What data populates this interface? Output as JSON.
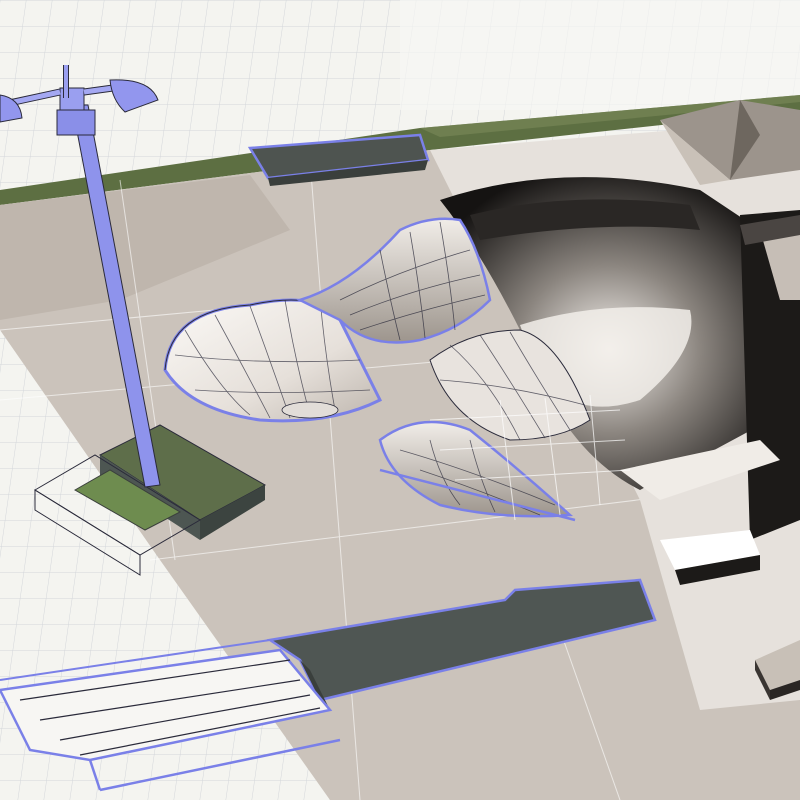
{
  "scene": {
    "subject": "skatepark-3d-model-viewport",
    "colors": {
      "background": "#f4f4f0",
      "grid_line": "#d8dadd",
      "grid_line_major": "#c4c7cc",
      "concrete": "#cbc3bb",
      "concrete_dark": "#a89f96",
      "deck_shadow": "#4e5450",
      "grass": "#5a7040",
      "wire_blue": "#7a80e8",
      "wire_edge": "#2a2a3a",
      "bowl_light": "#f3efeb",
      "bowl_dark": "#1e1c1a",
      "rendered_slab": "#e9e4df"
    },
    "objects": [
      "light-pole",
      "pole-base-planter",
      "bowl-left",
      "bowl-center",
      "bowl-right-rendered",
      "ledge-top",
      "ledge-lower",
      "rail-stairs",
      "pyramid-ramp",
      "bench-right"
    ]
  }
}
